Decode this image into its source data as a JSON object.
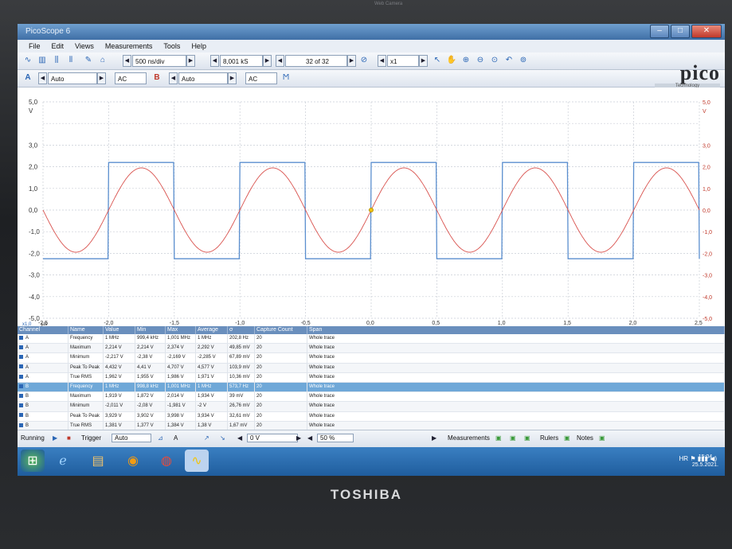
{
  "bezel": {
    "webcam_label": "Web Camera",
    "brand": "TOSHIBA"
  },
  "window": {
    "title": "PicoScope 6"
  },
  "menu": [
    "File",
    "Edit",
    "Views",
    "Measurements",
    "Tools",
    "Help"
  ],
  "toolbar": {
    "timebase": "500 ns/div",
    "samples": "8,001 kS",
    "capture": "32 of 32",
    "zoom": "x1"
  },
  "channels": {
    "a_range": "Auto",
    "a_coupling": "AC",
    "b_label": "B",
    "b_range": "Auto",
    "b_coupling": "AC",
    "a_label": "A"
  },
  "logo": {
    "name": "pico",
    "sub": "Technology"
  },
  "plot": {
    "left_axis": [
      "5,0",
      "V",
      "3,0",
      "2,0",
      "1,0",
      "0,0",
      "-1,0",
      "-2,0",
      "-3,0",
      "-4,0",
      "-5,0"
    ],
    "right_axis": [
      "5,0",
      "V",
      "3,0",
      "2,0",
      "1,0",
      "0,0",
      "-1,0",
      "-2,0",
      "-3,0",
      "-4,0",
      "-5,0"
    ],
    "x_axis": [
      "-2,5",
      "-2,0",
      "-1,5",
      "-1,0",
      "-0,5",
      "0,0",
      "0,5",
      "1,0",
      "1,5",
      "2,0",
      "2,5"
    ],
    "x_unit": "µs",
    "x_zoom": "x1,0"
  },
  "chart_data": {
    "type": "line",
    "xlabel": "µs",
    "ylabel": "V",
    "xlim": [
      -2.5,
      2.5
    ],
    "ylim": [
      -5,
      5
    ],
    "series": [
      {
        "name": "A",
        "color": "#5b8fcf",
        "shape": "square",
        "frequency_mhz": 1,
        "high_v": 2.2,
        "low_v": -2.25
      },
      {
        "name": "B",
        "color": "#d9534f",
        "shape": "sine",
        "frequency_mhz": 1,
        "amplitude_v": 1.95
      }
    ]
  },
  "table": {
    "headers": [
      "Channel",
      "Name",
      "Value",
      "Min",
      "Max",
      "Average",
      "σ",
      "Capture Count",
      "Span"
    ],
    "rows": [
      [
        "A",
        "Frequency",
        "1 MHz",
        "999,4 kHz",
        "1,001 MHz",
        "1 MHz",
        "202,8 Hz",
        "20",
        "Whole trace"
      ],
      [
        "A",
        "Maximum",
        "2,214 V",
        "2,214 V",
        "2,374 V",
        "2,292 V",
        "49,85 mV",
        "20",
        "Whole trace"
      ],
      [
        "A",
        "Minimum",
        "-2,217 V",
        "-2,38 V",
        "-2,169 V",
        "-2,285 V",
        "67,89 mV",
        "20",
        "Whole trace"
      ],
      [
        "A",
        "Peak To Peak",
        "4,432 V",
        "4,41 V",
        "4,707 V",
        "4,577 V",
        "103,9 mV",
        "20",
        "Whole trace"
      ],
      [
        "A",
        "True RMS",
        "1,962 V",
        "1,955 V",
        "1,986 V",
        "1,971 V",
        "10,36 mV",
        "20",
        "Whole trace"
      ],
      [
        "B",
        "Frequency",
        "1 MHz",
        "998,8 kHz",
        "1,001 MHz",
        "1 MHz",
        "573,7 Hz",
        "20",
        "Whole trace"
      ],
      [
        "B",
        "Maximum",
        "1,919 V",
        "1,872 V",
        "2,014 V",
        "1,934 V",
        "39 mV",
        "20",
        "Whole trace"
      ],
      [
        "B",
        "Minimum",
        "-2,011 V",
        "-2,08 V",
        "-1,981 V",
        "-2 V",
        "26,76 mV",
        "20",
        "Whole trace"
      ],
      [
        "B",
        "Peak To Peak",
        "3,929 V",
        "3,902 V",
        "3,998 V",
        "3,934 V",
        "32,61 mV",
        "20",
        "Whole trace"
      ],
      [
        "B",
        "True RMS",
        "1,381 V",
        "1,377 V",
        "1,384 V",
        "1,38 V",
        "1,67 mV",
        "20",
        "Whole trace"
      ]
    ]
  },
  "status": {
    "running": "Running",
    "trigger": "Trigger",
    "trigger_mode": "Auto",
    "trig_channel": "A",
    "trig_level": "0 V",
    "trig_percent": "50 %",
    "measurements": "Measurements",
    "rulers": "Rulers",
    "notes": "Notes"
  },
  "tray": {
    "lang": "HR",
    "time": "15:04",
    "date": "25.5.2021."
  }
}
